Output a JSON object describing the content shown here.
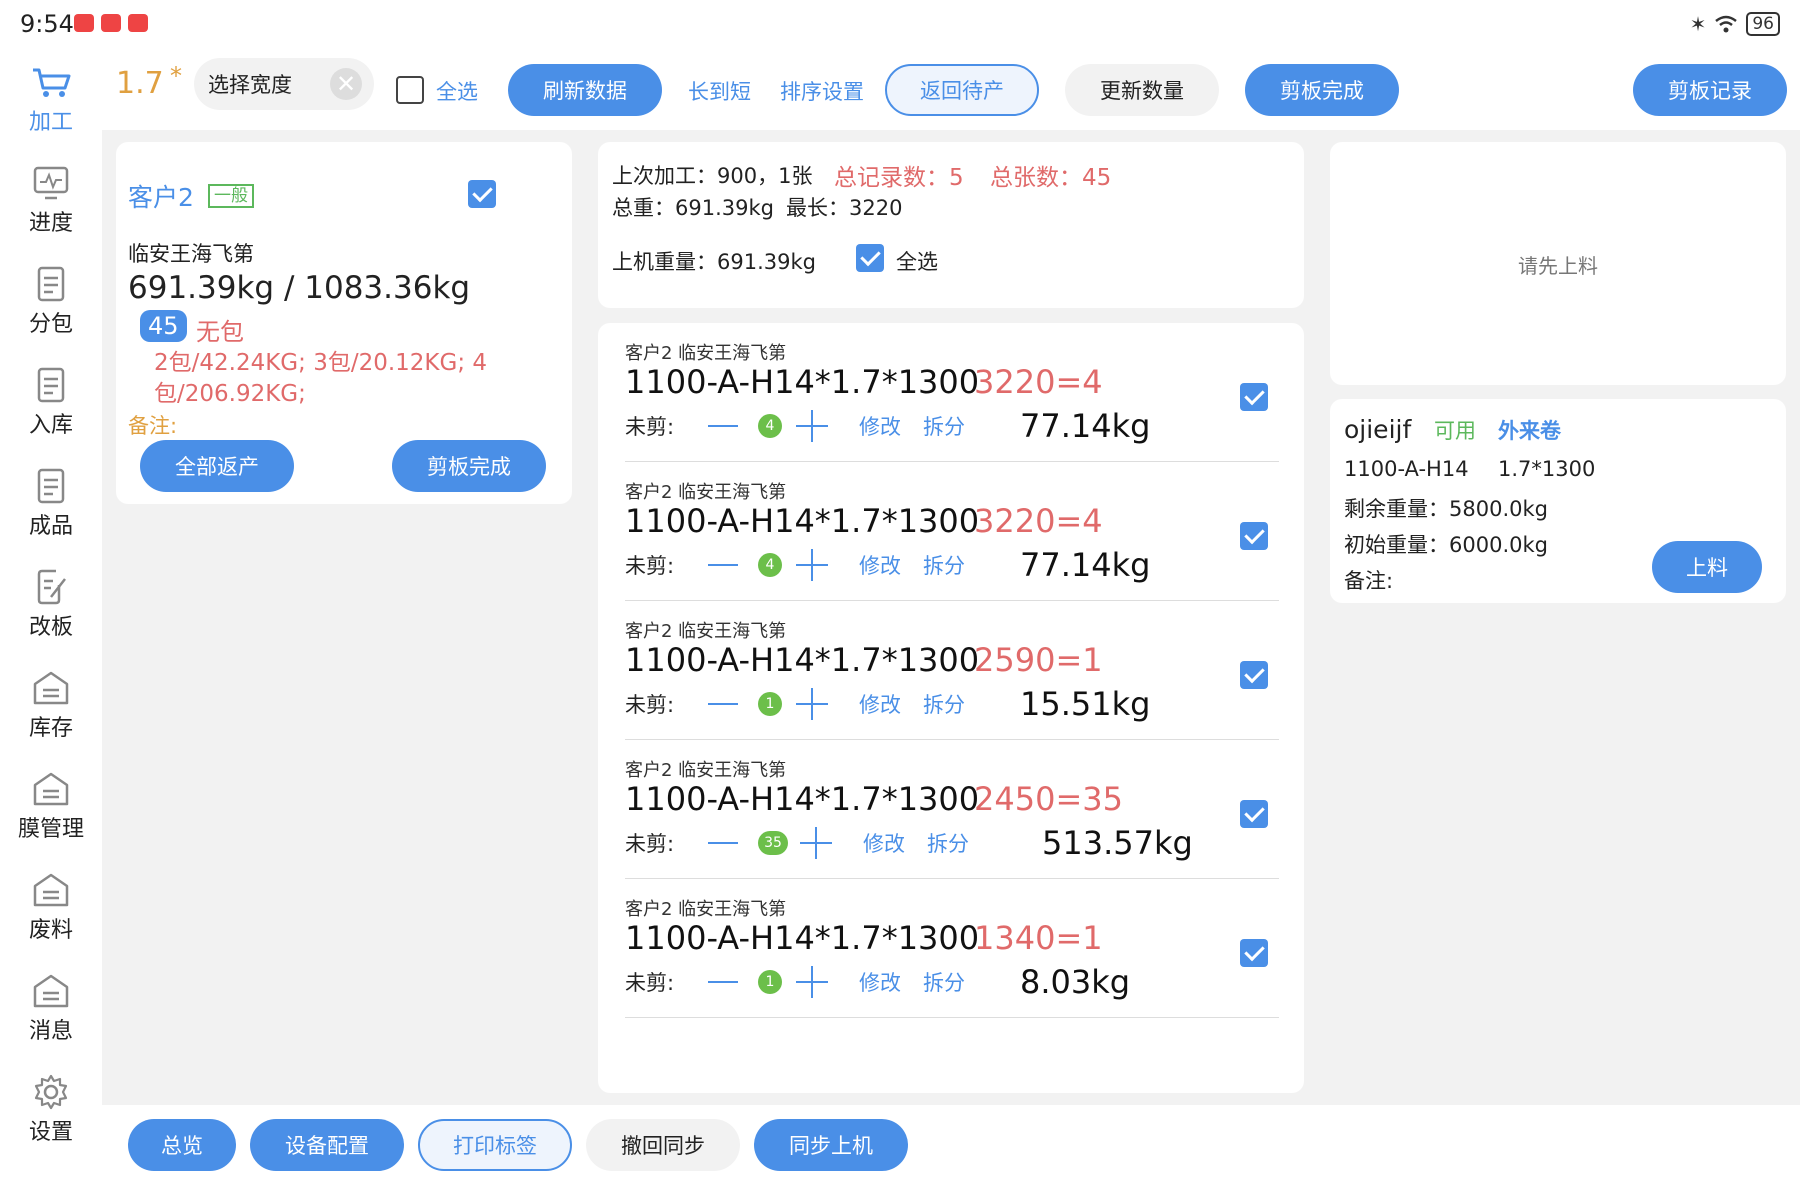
{
  "status_bar": {
    "time": "9:54",
    "battery": "96"
  },
  "sidebar": {
    "items": [
      {
        "label": "加工",
        "icon": "cart-icon",
        "active": true
      },
      {
        "label": "进度",
        "icon": "monitor-icon"
      },
      {
        "label": "分包",
        "icon": "document-icon"
      },
      {
        "label": "入库",
        "icon": "document-icon"
      },
      {
        "label": "成品",
        "icon": "document-icon"
      },
      {
        "label": "改板",
        "icon": "edit-document-icon"
      },
      {
        "label": "库存",
        "icon": "warehouse-icon"
      },
      {
        "label": "膜管理",
        "icon": "warehouse-icon"
      },
      {
        "label": "废料",
        "icon": "warehouse-icon"
      },
      {
        "label": "消息",
        "icon": "warehouse-icon"
      },
      {
        "label": "设置",
        "icon": "gear-icon"
      }
    ]
  },
  "toolbar": {
    "thickness": "1.7",
    "required_mark": "*",
    "width_select_placeholder": "选择宽度",
    "select_all": "全选",
    "refresh": "刷新数据",
    "long_to_short": "长到短",
    "sort_settings": "排序设置",
    "return_pending": "返回待产",
    "update_quantity": "更新数量",
    "cut_done": "剪板完成",
    "cut_records": "剪板记录"
  },
  "customer_card": {
    "name": "客户2",
    "tag": "一般",
    "company": "临安王海飞第",
    "weight": "691.39kg / 1083.36kg",
    "count": "45",
    "pack_status": "无包",
    "packages": "2包/42.24KG; 3包/20.12KG; 4包/206.92KG;",
    "remark_label": "备注:",
    "return_all": "全部返产",
    "cut_done": "剪板完成"
  },
  "summary": {
    "last_process": "上次加工：900，1张",
    "total_records": "总记录数：5",
    "total_sheets": "总张数：45",
    "total_weight": "总重：691.39kg",
    "max_length": "最长：3220",
    "machine_weight": "上机重量：691.39kg",
    "select_all": "全选"
  },
  "order_rows": [
    {
      "title": "客户2  临安王海飞第",
      "spec": "1100-A-H14*1.7*1300",
      "length_qty": "3220=4",
      "uncut_label": "未剪:",
      "count": "4",
      "edit": "修改",
      "split": "拆分",
      "weight": "77.14kg"
    },
    {
      "title": "客户2  临安王海飞第",
      "spec": "1100-A-H14*1.7*1300",
      "length_qty": "3220=4",
      "uncut_label": "未剪:",
      "count": "4",
      "edit": "修改",
      "split": "拆分",
      "weight": "77.14kg"
    },
    {
      "title": "客户2  临安王海飞第",
      "spec": "1100-A-H14*1.7*1300",
      "length_qty": "2590=1",
      "uncut_label": "未剪:",
      "count": "1",
      "edit": "修改",
      "split": "拆分",
      "weight": "15.51kg"
    },
    {
      "title": "客户2  临安王海飞第",
      "spec": "1100-A-H14*1.7*1300",
      "length_qty": "2450=35",
      "uncut_label": "未剪:",
      "count": "35",
      "edit": "修改",
      "split": "拆分",
      "weight": "513.57kg"
    },
    {
      "title": "客户2  临安王海飞第",
      "spec": "1100-A-H14*1.7*1300",
      "length_qty": "1340=1",
      "uncut_label": "未剪:",
      "count": "1",
      "edit": "修改",
      "split": "拆分",
      "weight": "8.03kg"
    }
  ],
  "load_panel": {
    "prompt": "请先上料"
  },
  "coil_card": {
    "name": "ojieijf",
    "status": "可用",
    "source": "外来卷",
    "alloy": "1100-A-H14",
    "size": "1.7*1300",
    "remaining_weight": "剩余重量：5800.0kg",
    "initial_weight": "初始重量：6000.0kg",
    "remark": "备注:",
    "load_button": "上料"
  },
  "bottom_bar": {
    "overview": "总览",
    "device_config": "设备配置",
    "print_label": "打印标签",
    "revoke_sync": "撤回同步",
    "sync_machine": "同步上机"
  },
  "colors": {
    "accent": "#4a8fe7",
    "danger": "#e06a6a",
    "success": "#6cbf4a",
    "warning": "#e0a040"
  }
}
